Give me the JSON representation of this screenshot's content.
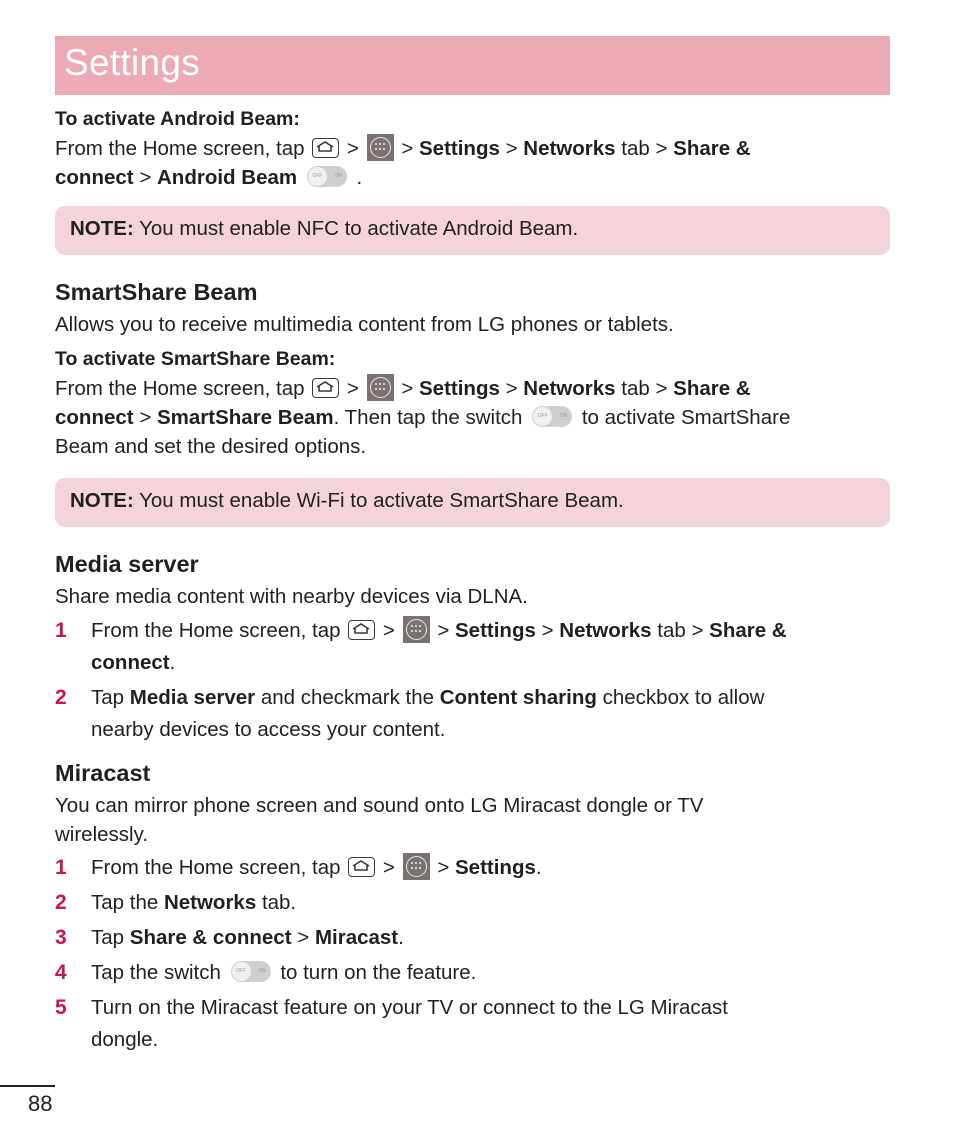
{
  "header": {
    "title": "Settings",
    "banner_color": "#ecaab7"
  },
  "android_beam": {
    "subheading": "To activate Android Beam:",
    "line1_prefix": "From the Home screen, tap",
    "sep": ">",
    "settings": "Settings",
    "networks": "Networks",
    "tab": "tab",
    "share_connect_1": "Share &",
    "share_connect_2": "connect",
    "target": "Android Beam",
    "end": "."
  },
  "note1": {
    "label": "NOTE:",
    "text": "You must enable NFC to activate Android Beam."
  },
  "smartshare": {
    "heading": "SmartShare Beam",
    "description": "Allows you to receive multimedia content from LG phones or tablets.",
    "subheading": "To activate SmartShare Beam:",
    "line1_prefix": "From the Home screen, tap",
    "settings": "Settings",
    "networks": "Networks",
    "tab": "tab",
    "share_connect_1": "Share &",
    "share_connect_2": "connect",
    "target": "SmartShare Beam",
    "then": ". Then tap the switch",
    "after_switch": "to activate SmartShare",
    "line3": "Beam and set the desired options."
  },
  "note2": {
    "label": "NOTE:",
    "text": "You must enable Wi-Fi to activate SmartShare Beam."
  },
  "media_server": {
    "heading": "Media server",
    "description": "Share media content with nearby devices via DLNA.",
    "steps": [
      {
        "num": "1",
        "prefix": "From the Home screen, tap",
        "settings": "Settings",
        "networks": "Networks",
        "tab": "tab",
        "share1": "Share &",
        "share2": "connect",
        "end": "."
      },
      {
        "num": "2",
        "tap": "Tap",
        "media_server": "Media server",
        "mid": "and checkmark the",
        "content_sharing": "Content sharing",
        "rest1": "checkbox to allow",
        "rest2": "nearby devices to access your content."
      }
    ]
  },
  "miracast": {
    "heading": "Miracast",
    "description1": "You can mirror phone screen and sound onto LG Miracast dongle or TV",
    "description2": "wirelessly.",
    "steps": [
      {
        "num": "1",
        "prefix": "From the Home screen, tap",
        "settings": "Settings",
        "end": "."
      },
      {
        "num": "2",
        "prefix": "Tap the",
        "networks": "Networks",
        "rest": "tab."
      },
      {
        "num": "3",
        "prefix": "Tap",
        "share": "Share & connect",
        "miracast": "Miracast",
        "end": "."
      },
      {
        "num": "4",
        "prefix": "Tap the switch",
        "rest": "to turn on the feature."
      },
      {
        "num": "5",
        "line1": "Turn on the Miracast feature on your TV or connect to the LG Miracast",
        "line2": "dongle."
      }
    ]
  },
  "icons": {
    "home": "home-key-icon",
    "apps": "apps-icon",
    "switch": "off-on-switch-icon",
    "switch_off": "OFF",
    "switch_on": "ON"
  },
  "accent_color": "#c8174f",
  "note_bg": "#f5d3da",
  "footer": {
    "page_number": "88"
  }
}
